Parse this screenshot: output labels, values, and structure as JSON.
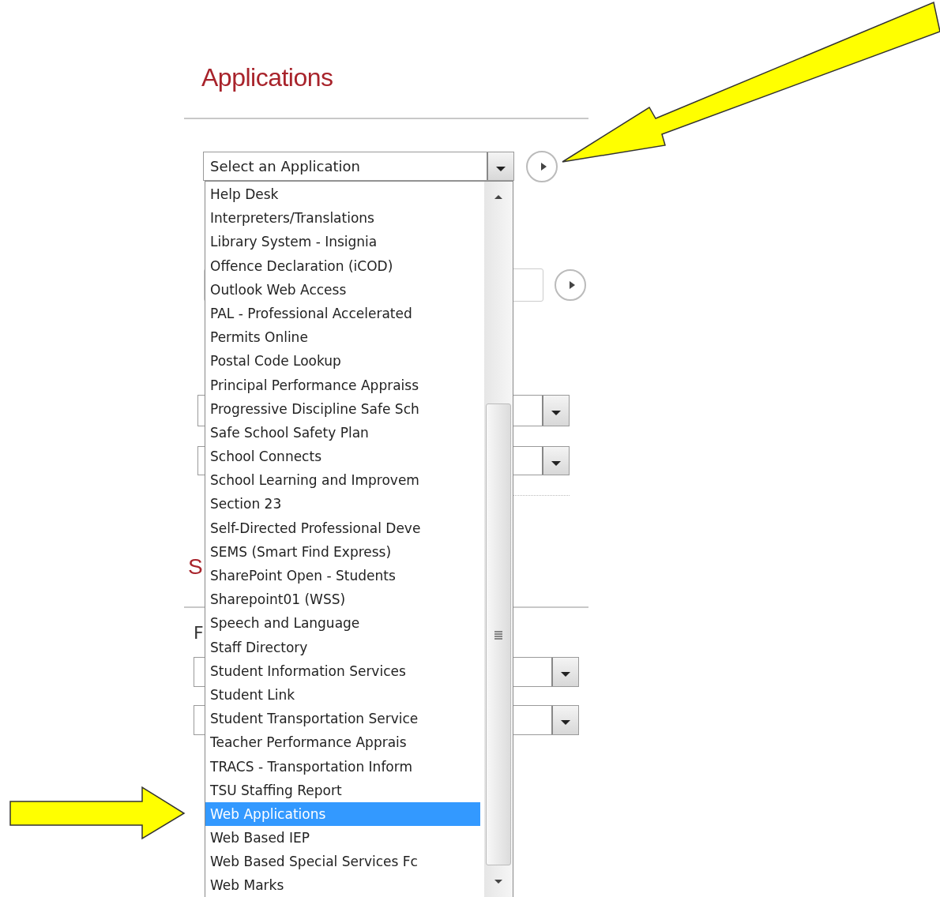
{
  "page_title": "Applications",
  "app_select": {
    "value": "Select an Application",
    "expanded": true,
    "options": [
      {
        "label": "Help Desk",
        "selected": false
      },
      {
        "label": "Interpreters/Translations",
        "selected": false
      },
      {
        "label": "Library System - Insignia",
        "selected": false
      },
      {
        "label": "Offence Declaration (iCOD)",
        "selected": false
      },
      {
        "label": "Outlook Web Access",
        "selected": false
      },
      {
        "label": "PAL - Professional Accelerated",
        "selected": false
      },
      {
        "label": "Permits Online",
        "selected": false
      },
      {
        "label": "Postal Code Lookup",
        "selected": false
      },
      {
        "label": "Principal Performance Appraiss",
        "selected": false
      },
      {
        "label": "Progressive Discipline Safe Sch",
        "selected": false
      },
      {
        "label": "Safe School Safety Plan",
        "selected": false
      },
      {
        "label": "School Connects",
        "selected": false
      },
      {
        "label": "School Learning and Improvem",
        "selected": false
      },
      {
        "label": "Section 23",
        "selected": false
      },
      {
        "label": "Self-Directed Professional Deve",
        "selected": false
      },
      {
        "label": "SEMS (Smart Find Express)",
        "selected": false
      },
      {
        "label": "SharePoint Open - Students",
        "selected": false
      },
      {
        "label": "Sharepoint01 (WSS)",
        "selected": false
      },
      {
        "label": "Speech and Language",
        "selected": false
      },
      {
        "label": "Staff Directory",
        "selected": false
      },
      {
        "label": "Student Information Services",
        "selected": false
      },
      {
        "label": "Student Link",
        "selected": false
      },
      {
        "label": "Student Transportation Service",
        "selected": false
      },
      {
        "label": "Teacher Performance Apprais",
        "selected": false
      },
      {
        "label": "TRACS - Transportation Inform",
        "selected": false
      },
      {
        "label": "TSU Staffing Report",
        "selected": false
      },
      {
        "label": "Web Applications",
        "selected": true
      },
      {
        "label": "Web Based IEP",
        "selected": false
      },
      {
        "label": "Web Based Special Services Fc",
        "selected": false
      },
      {
        "label": "Web Marks",
        "selected": false
      }
    ]
  },
  "section_2_heading": "S",
  "field_label": "F"
}
